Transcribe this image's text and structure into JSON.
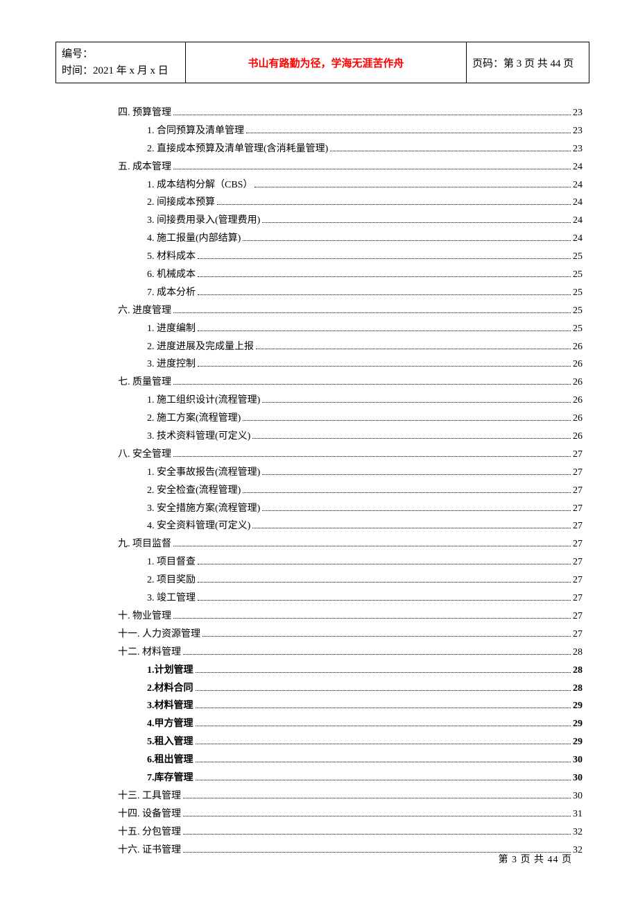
{
  "header": {
    "left_line1": "编号：",
    "left_line2": "时间：2021 年 x 月 x 日",
    "center": "书山有路勤为径，学海无涯苦作舟",
    "right": "页码：第 3 页 共 44 页"
  },
  "toc": [
    {
      "level": "lvl1",
      "label": "四. 预算管理",
      "page": "23"
    },
    {
      "level": "lvl2",
      "label": "1. 合同预算及清单管理",
      "page": "23"
    },
    {
      "level": "lvl2",
      "label": "2. 直接成本预算及清单管理(含消耗量管理)",
      "page": "23"
    },
    {
      "level": "lvl1",
      "label": "五. 成本管理",
      "page": "24"
    },
    {
      "level": "lvl2",
      "label": "1. 成本结构分解（CBS）",
      "page": "24"
    },
    {
      "level": "lvl2",
      "label": "2. 间接成本预算",
      "page": "24"
    },
    {
      "level": "lvl2",
      "label": "3. 间接费用录入(管理费用)",
      "page": "24"
    },
    {
      "level": "lvl2",
      "label": "4. 施工报量(内部结算)",
      "page": "24"
    },
    {
      "level": "lvl2",
      "label": "5. 材料成本",
      "page": "25"
    },
    {
      "level": "lvl2",
      "label": "6. 机械成本",
      "page": "25"
    },
    {
      "level": "lvl2",
      "label": "7. 成本分析",
      "page": "25"
    },
    {
      "level": "lvl1",
      "label": "六. 进度管理",
      "page": "25"
    },
    {
      "level": "lvl2",
      "label": "1. 进度编制",
      "page": "25"
    },
    {
      "level": "lvl2",
      "label": "2. 进度进展及完成量上报",
      "page": "26"
    },
    {
      "level": "lvl2",
      "label": "3. 进度控制",
      "page": "26"
    },
    {
      "level": "lvl1",
      "label": "七. 质量管理",
      "page": "26"
    },
    {
      "level": "lvl2",
      "label": "1. 施工组织设计(流程管理)",
      "page": "26"
    },
    {
      "level": "lvl2",
      "label": "2. 施工方案(流程管理)",
      "page": "26"
    },
    {
      "level": "lvl2",
      "label": "3. 技术资料管理(可定义)",
      "page": "26"
    },
    {
      "level": "lvl1",
      "label": "八. 安全管理",
      "page": "27"
    },
    {
      "level": "lvl2",
      "label": "1. 安全事故报告(流程管理)",
      "page": "27"
    },
    {
      "level": "lvl2",
      "label": "2. 安全检查(流程管理)",
      "page": "27"
    },
    {
      "level": "lvl2",
      "label": "3. 安全措施方案(流程管理)",
      "page": "27"
    },
    {
      "level": "lvl2",
      "label": "4. 安全资料管理(可定义)",
      "page": "27"
    },
    {
      "level": "lvl1",
      "label": "九. 项目监督",
      "page": "27"
    },
    {
      "level": "lvl2",
      "label": "1. 项目督查",
      "page": "27"
    },
    {
      "level": "lvl2",
      "label": "2. 项目奖励",
      "page": "27"
    },
    {
      "level": "lvl2",
      "label": "3. 竣工管理",
      "page": "27"
    },
    {
      "level": "lvl1",
      "label": "十. 物业管理",
      "page": "27"
    },
    {
      "level": "lvl1",
      "label": "十一. 人力资源管理",
      "page": "27"
    },
    {
      "level": "lvl1",
      "label": "十二. 材料管理",
      "page": "28"
    },
    {
      "level": "lvl2b",
      "label": "1.计划管理",
      "page": "28"
    },
    {
      "level": "lvl2b",
      "label": "2.材料合同",
      "page": "28"
    },
    {
      "level": "lvl2b",
      "label": "3.材料管理",
      "page": "29"
    },
    {
      "level": "lvl2b",
      "label": "4.甲方管理",
      "page": "29"
    },
    {
      "level": "lvl2b",
      "label": "5.租入管理",
      "page": "29"
    },
    {
      "level": "lvl2b",
      "label": "6.租出管理",
      "page": "30"
    },
    {
      "level": "lvl2b",
      "label": "7.库存管理",
      "page": "30"
    },
    {
      "level": "lvl1",
      "label": "十三. 工具管理",
      "page": "30"
    },
    {
      "level": "lvl1",
      "label": "十四. 设备管理",
      "page": "31"
    },
    {
      "level": "lvl1",
      "label": "十五. 分包管理",
      "page": "32"
    },
    {
      "level": "lvl1",
      "label": "十六. 证书管理",
      "page": "32"
    }
  ],
  "footer": "第 3 页 共 44 页"
}
